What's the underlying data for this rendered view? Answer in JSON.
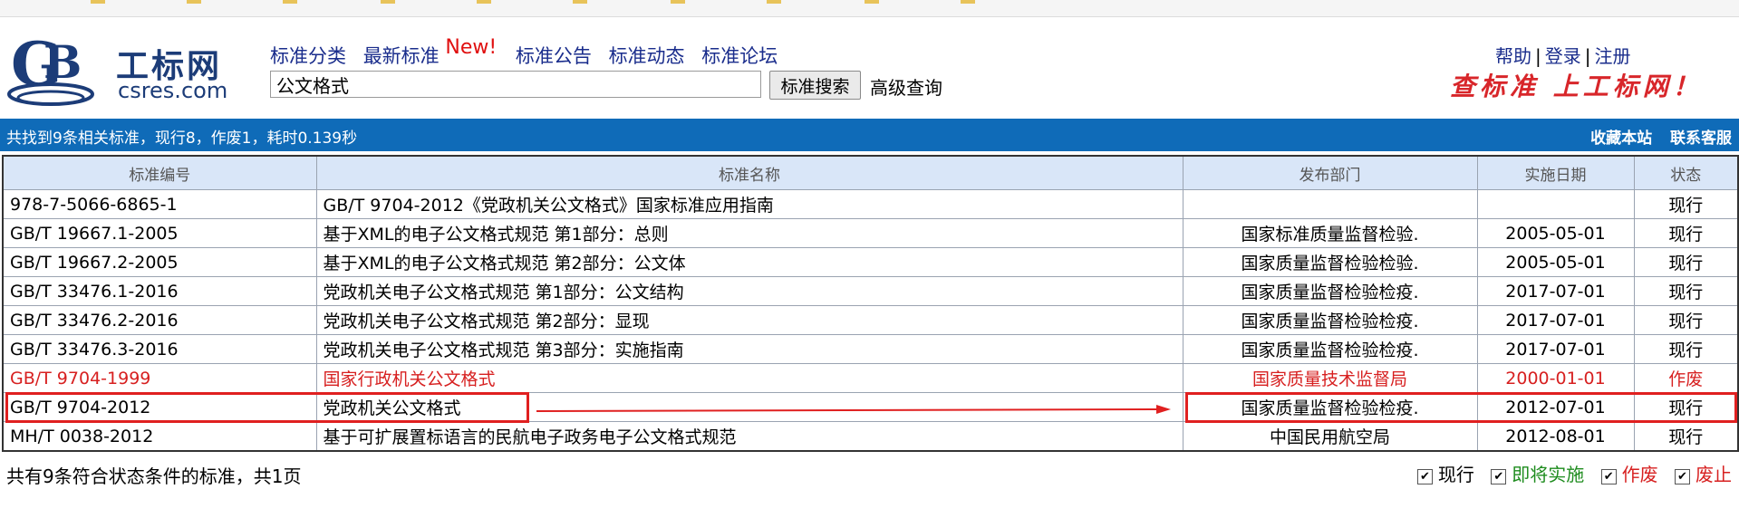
{
  "header": {
    "logo_cn": "工标网",
    "logo_en": "csres.com",
    "nav": [
      "标准分类",
      "最新标准",
      "标准公告",
      "标准动态",
      "标准论坛"
    ],
    "new_badge": "New!",
    "search_value": "公文格式",
    "search_button": "标准搜索",
    "advanced_search": "高级查询",
    "account": [
      "帮助",
      "登录",
      "注册"
    ],
    "account_separator": "|",
    "slogan": "查标准 上工标网！"
  },
  "result_bar": {
    "summary": "共找到9条相关标准，现行8，作废1，耗时0.139秒",
    "links": [
      "收藏本站",
      "联系客服"
    ]
  },
  "table": {
    "columns": [
      "标准编号",
      "标准名称",
      "发布部门",
      "实施日期",
      "状态"
    ],
    "rows": [
      {
        "code": "978-7-5066-6865-1",
        "name": "GB/T 9704-2012《党政机关公文格式》国家标准应用指南",
        "dept": "",
        "date": "",
        "status": "现行"
      },
      {
        "code": "GB/T 19667.1-2005",
        "name": "基于XML的电子公文格式规范 第1部分：总则",
        "dept": "国家标准质量监督检验.",
        "date": "2005-05-01",
        "status": "现行"
      },
      {
        "code": "GB/T 19667.2-2005",
        "name": "基于XML的电子公文格式规范 第2部分：公文体",
        "dept": "国家质量监督检验检验.",
        "date": "2005-05-01",
        "status": "现行"
      },
      {
        "code": "GB/T 33476.1-2016",
        "name": "党政机关电子公文格式规范 第1部分：公文结构",
        "dept": "国家质量监督检验检疫.",
        "date": "2017-07-01",
        "status": "现行"
      },
      {
        "code": "GB/T 33476.2-2016",
        "name": "党政机关电子公文格式规范 第2部分：显现",
        "dept": "国家质量监督检验检疫.",
        "date": "2017-07-01",
        "status": "现行"
      },
      {
        "code": "GB/T 33476.3-2016",
        "name": "党政机关电子公文格式规范 第3部分：实施指南",
        "dept": "国家质量监督检验检疫.",
        "date": "2017-07-01",
        "status": "现行"
      },
      {
        "code": "GB/T 9704-1999",
        "name": "国家行政机关公文格式",
        "dept": "国家质量技术监督局",
        "date": "2000-01-01",
        "status": "作废",
        "abolished": true
      },
      {
        "code": "GB/T 9704-2012",
        "name": "党政机关公文格式",
        "dept": "国家质量监督检验检疫.",
        "date": "2012-07-01",
        "status": "现行"
      },
      {
        "code": "MH/T 0038-2012",
        "name": "基于可扩展置标语言的民航电子政务电子公文格式规范",
        "dept": "中国民用航空局",
        "date": "2012-08-01",
        "status": "现行"
      }
    ]
  },
  "footer": {
    "summary": "共有9条符合状态条件的标准，共1页",
    "filters": [
      {
        "label": "现行",
        "color": "#000000",
        "checked": true
      },
      {
        "label": "即将实施",
        "color": "#1e8c1e",
        "checked": true
      },
      {
        "label": "作废",
        "color": "#d72020",
        "checked": true
      },
      {
        "label": "废止",
        "color": "#d72020",
        "checked": true
      }
    ]
  },
  "colors": {
    "brand_blue": "#0f6bb8",
    "link_blue": "#1a2d8c",
    "highlight_red": "#e02020",
    "header_row": "#d9e6f8"
  }
}
